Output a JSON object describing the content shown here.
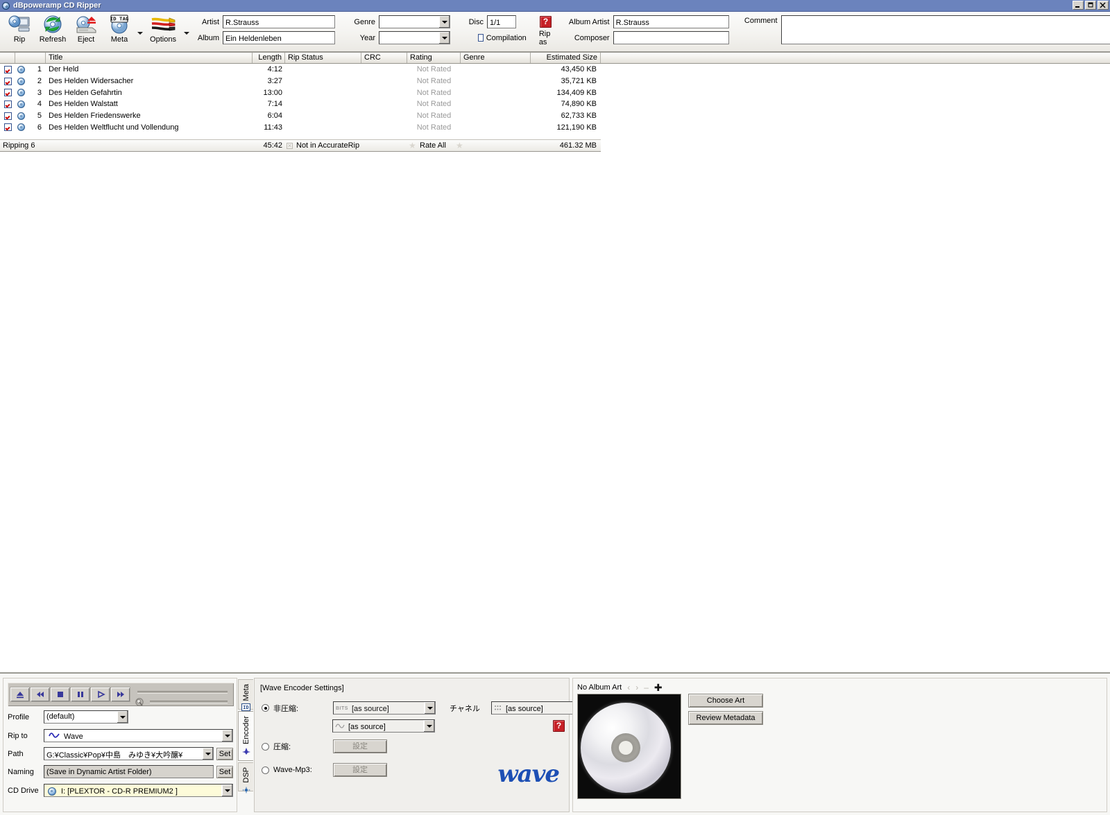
{
  "window": {
    "title": "dBpoweramp CD Ripper",
    "icon": "cd-disc-icon",
    "buttons": [
      {
        "name": "minimize",
        "glyph": "_"
      },
      {
        "name": "restore",
        "glyph": "❐"
      },
      {
        "name": "close",
        "glyph": "✕"
      }
    ]
  },
  "toolbar": {
    "buttons": [
      {
        "label": "Rip",
        "icon": "rip-computer-icon"
      },
      {
        "label": "Refresh",
        "icon": "refresh-disc-icon"
      },
      {
        "label": "Eject",
        "icon": "eject-drive-icon"
      },
      {
        "label": "Meta",
        "icon": "id-tag-disc-icon",
        "has_caret": true
      },
      {
        "label": "Options",
        "icon": "audio-cables-icon",
        "has_caret": true
      }
    ]
  },
  "metadata": {
    "artist_label": "Artist",
    "artist_value": "R.Strauss",
    "album_label": "Album",
    "album_value": "Ein Heldenleben",
    "genre_label": "Genre",
    "genre_value": "",
    "year_label": "Year",
    "year_value": "",
    "disc_label": "Disc",
    "disc_value": "1/1",
    "help_glyph": "?",
    "compilation_label": "Compilation",
    "compilation_checked": false,
    "rip_as_label": "Rip as",
    "album_artist_label": "Album Artist",
    "album_artist_value": "R.Strauss",
    "composer_label": "Composer",
    "composer_value": "",
    "comment_label": "Comment",
    "comment_value": ""
  },
  "tracks": {
    "columns": [
      "Title",
      "Length",
      "Rip Status",
      "CRC",
      "Rating",
      "Genre",
      "Estimated Size"
    ],
    "rows": [
      {
        "checked": true,
        "num": "1",
        "title": "Der Held",
        "length": "4:12",
        "rip_status": "",
        "crc": "",
        "rating": "Not Rated",
        "genre": "",
        "size": "43,450 KB"
      },
      {
        "checked": true,
        "num": "2",
        "title": "Des Helden Widersacher",
        "length": "3:27",
        "rip_status": "",
        "crc": "",
        "rating": "Not Rated",
        "genre": "",
        "size": "35,721 KB"
      },
      {
        "checked": true,
        "num": "3",
        "title": "Des Helden Gefahrtin",
        "length": "13:00",
        "rip_status": "",
        "crc": "",
        "rating": "Not Rated",
        "genre": "",
        "size": "134,409 KB"
      },
      {
        "checked": true,
        "num": "4",
        "title": "Des Helden Walstatt",
        "length": "7:14",
        "rip_status": "",
        "crc": "",
        "rating": "Not Rated",
        "genre": "",
        "size": "74,890 KB"
      },
      {
        "checked": true,
        "num": "5",
        "title": "Des Helden Friedenswerke",
        "length": "6:04",
        "rip_status": "",
        "crc": "",
        "rating": "Not Rated",
        "genre": "",
        "size": "62,733 KB"
      },
      {
        "checked": true,
        "num": "6",
        "title": "Des Helden Weltflucht und Vollendung",
        "length": "11:43",
        "rip_status": "",
        "crc": "",
        "rating": "Not Rated",
        "genre": "",
        "size": "121,190 KB"
      }
    ],
    "summary": {
      "status": "Ripping 6",
      "total_length": "45:42",
      "accuraterip": "Not in AccurateRip",
      "rate_all": "Rate All",
      "total_size": "461.32 MB"
    }
  },
  "transport": {
    "buttons": [
      {
        "name": "eject-button",
        "icon": "eject-icon"
      },
      {
        "name": "previous-button",
        "icon": "rewind-icon"
      },
      {
        "name": "stop-button",
        "icon": "stop-icon"
      },
      {
        "name": "pause-button",
        "icon": "pause-icon"
      },
      {
        "name": "play-button",
        "icon": "play-icon"
      },
      {
        "name": "next-button",
        "icon": "fast-forward-icon"
      }
    ]
  },
  "rip_settings": {
    "profile_label": "Profile",
    "profile_value": "(default)",
    "rip_to_label": "Rip to",
    "rip_to_value": "Wave",
    "path_label": "Path",
    "path_value": "G:¥Classic¥Pop¥中島　みゆき¥大吟醸¥",
    "naming_label": "Naming",
    "naming_value": "(Save in Dynamic Artist Folder)",
    "cd_drive_label": "CD Drive",
    "cd_drive_value": "I:  [PLEXTOR  - CD-R  PREMIUM2 ]",
    "set_label": "Set"
  },
  "side_tabs": [
    {
      "label": "Meta",
      "icon": "id-tag-icon",
      "active": false
    },
    {
      "label": "Encoder",
      "icon": "encoder-icon",
      "active": true
    },
    {
      "label": "DSP",
      "icon": "dsp-icon",
      "active": false
    }
  ],
  "encoder": {
    "title": "[Wave Encoder Settings]",
    "uncompressed_label": "非圧縮:",
    "uncompressed_selected": true,
    "bits_value": "[as source]",
    "bits_icon": "bits-icon",
    "freq_value": "[as source]",
    "freq_icon": "waveform-icon",
    "channel_label": "チャネル",
    "channel_value": "[as source]",
    "channel_icon": "channels-icon",
    "compressed_label": "圧縮:",
    "compressed_selected": false,
    "compressed_button": "設定",
    "wave_mp3_label": "Wave-Mp3:",
    "wave_mp3_selected": false,
    "wave_mp3_button": "設定",
    "help_glyph": "?",
    "logo_text": "wave"
  },
  "album_art": {
    "title": "No Album Art",
    "nav_prev": "‹",
    "nav_next": "›",
    "nav_remove": "–",
    "nav_add": "✚",
    "choose_art_label": "Choose Art",
    "review_metadata_label": "Review Metadata"
  }
}
